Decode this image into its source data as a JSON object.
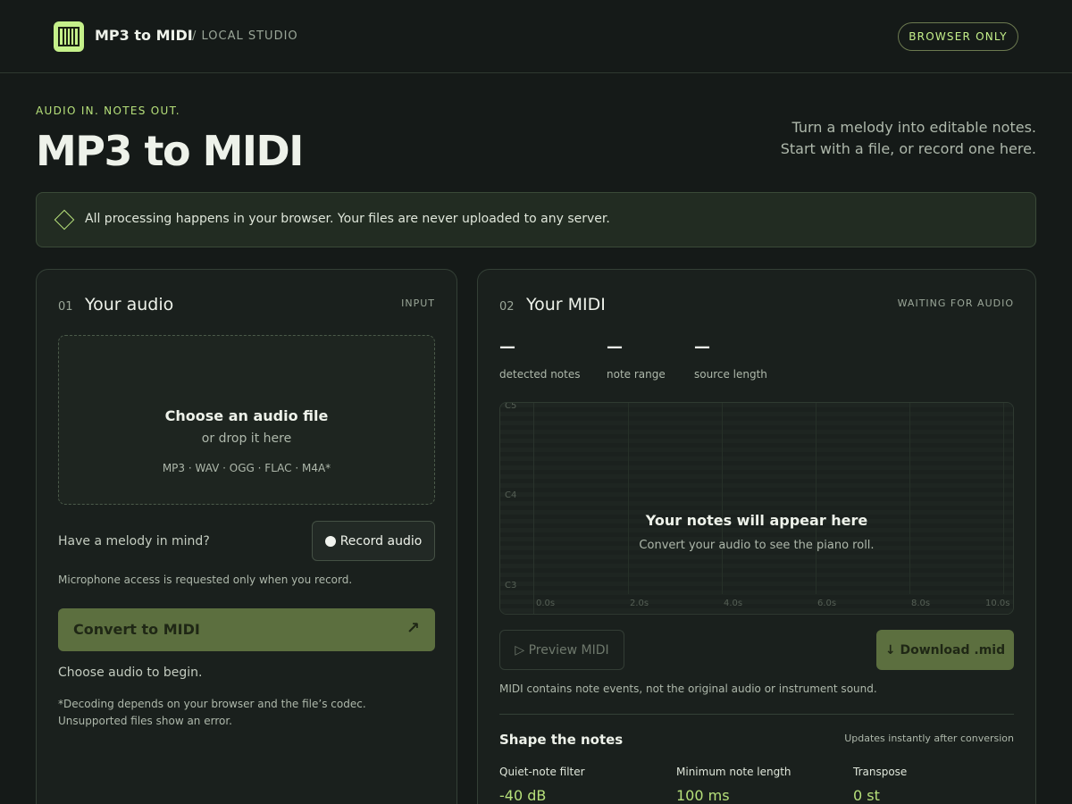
{
  "header": {
    "brand": "MP3 to MIDI",
    "subtitle": "/ LOCAL STUDIO",
    "badge": "BROWSER ONLY"
  },
  "hero": {
    "eyebrow": "AUDIO IN. NOTES OUT.",
    "title": "MP3 to MIDI",
    "desc_line1": "Turn a melody into editable notes.",
    "desc_line2": "Start with a file, or record one here."
  },
  "notice": "All processing happens in your browser. Your files are never uploaded to any server.",
  "input_card": {
    "number": "01",
    "title": "Your audio",
    "tag": "INPUT",
    "dropzone": {
      "title": "Choose an audio file",
      "sub": "or drop it here",
      "formats": "MP3 · WAV · OGG · FLAC · M4A*"
    },
    "melody_prompt": "Have a melody in mind?",
    "record_label": "Record audio",
    "mic_note": "Microphone access is requested only when you record.",
    "convert_label": "Convert to MIDI",
    "convert_arrow": "↗",
    "status": "Choose audio to begin.",
    "footnote": "*Decoding depends on your browser and the file’s codec. Unsupported files show an error."
  },
  "output_card": {
    "number": "02",
    "title": "Your MIDI",
    "tag": "WAITING FOR AUDIO",
    "stats": [
      {
        "value": "—",
        "label": "detected notes"
      },
      {
        "value": "—",
        "label": "note range"
      },
      {
        "value": "—",
        "label": "source length"
      }
    ],
    "roll": {
      "pitch_labels": [
        "C5",
        "C4",
        "C3"
      ],
      "time_labels": [
        "0.0s",
        "2.0s",
        "4.0s",
        "6.0s",
        "8.0s",
        "10.0s"
      ],
      "empty_title": "Your notes will appear here",
      "empty_sub": "Convert your audio to see the piano roll."
    },
    "preview_label": "▷ Preview MIDI",
    "download_label": "↓ Download .mid",
    "midi_note": "MIDI contains note events, not the original audio or instrument sound.",
    "shape_title": "Shape the notes",
    "shape_meta": "Updates instantly after conversion",
    "controls": [
      {
        "label": "Quiet-note filter",
        "value": "-40 dB"
      },
      {
        "label": "Minimum note length",
        "value": "100 ms"
      },
      {
        "label": "Transpose",
        "value": "0 st"
      }
    ]
  },
  "colors": {
    "accent": "#c5f08a",
    "button": "#5c6f3f",
    "background": "#151a18"
  }
}
